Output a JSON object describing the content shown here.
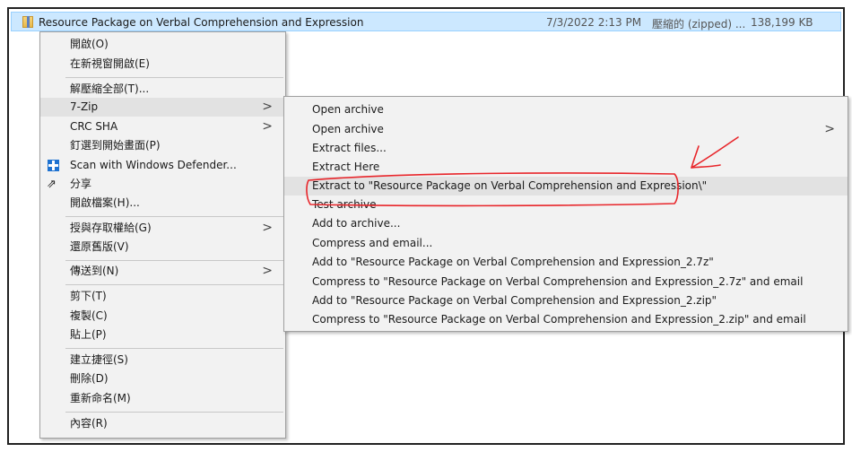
{
  "file": {
    "name": "Resource Package on Verbal Comprehension and Expression",
    "date": "7/3/2022 2:13 PM",
    "type": "壓縮的 (zipped) ...",
    "size": "138,199 KB"
  },
  "context_menu": {
    "items": [
      {
        "label": "開啟(O)"
      },
      {
        "label": "在新視窗開啟(E)"
      },
      {
        "label": "解壓縮全部(T)..."
      },
      {
        "label": "7-Zip"
      },
      {
        "label": "CRC SHA"
      },
      {
        "label": "釘選到開始畫面(P)"
      },
      {
        "label": "Scan with Windows Defender..."
      },
      {
        "label": "分享"
      },
      {
        "label": "開啟檔案(H)..."
      },
      {
        "label": "授與存取權給(G)"
      },
      {
        "label": "還原舊版(V)"
      },
      {
        "label": "傳送到(N)"
      },
      {
        "label": "剪下(T)"
      },
      {
        "label": "複製(C)"
      },
      {
        "label": "貼上(P)"
      },
      {
        "label": "建立捷徑(S)"
      },
      {
        "label": "刪除(D)"
      },
      {
        "label": "重新命名(M)"
      },
      {
        "label": "內容(R)"
      }
    ]
  },
  "submenu_7zip": {
    "items": [
      {
        "label": "Open archive"
      },
      {
        "label": "Open archive"
      },
      {
        "label": "Extract files..."
      },
      {
        "label": "Extract Here"
      },
      {
        "label": "Extract to \"Resource Package on Verbal Comprehension and Expression\\\""
      },
      {
        "label": "Test archive"
      },
      {
        "label": "Add to archive..."
      },
      {
        "label": "Compress and email..."
      },
      {
        "label": "Add to \"Resource Package on Verbal Comprehension and Expression_2.7z\""
      },
      {
        "label": "Compress to \"Resource Package on Verbal Comprehension and Expression_2.7z\" and email"
      },
      {
        "label": "Add to \"Resource Package on Verbal Comprehension and Expression_2.zip\""
      },
      {
        "label": "Compress to \"Resource Package on Verbal Comprehension and Expression_2.zip\" and email"
      }
    ]
  },
  "icons": {
    "arrow": "chevron-right-icon",
    "defender": "windows-defender-icon",
    "share": "share-icon",
    "folder": "zip-folder-icon"
  },
  "colors": {
    "selection": "#cce8ff",
    "menu_bg": "#f2f2f2",
    "hover": "#e2e2e2",
    "annotation": "#e8262b"
  }
}
